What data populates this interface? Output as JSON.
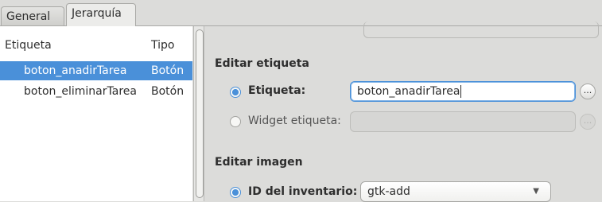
{
  "tabs": [
    {
      "label": "General"
    },
    {
      "label": "Jerarquía"
    }
  ],
  "tree": {
    "columns": [
      "Etiqueta",
      "Tipo"
    ],
    "rows": [
      {
        "etiqueta": "boton_anadirTarea",
        "tipo": "Botón"
      },
      {
        "etiqueta": "boton_eliminarTarea",
        "tipo": "Botón"
      }
    ]
  },
  "editor": {
    "edit_label_section": "Editar etiqueta",
    "label_option": "Etiqueta:",
    "label_value": "boton_anadirTarea",
    "widget_label_option": "Widget etiqueta:",
    "widget_label_value": "",
    "edit_image_section": "Editar imagen",
    "stock_id_option": "ID del inventario:",
    "stock_id_value": "gtk-add",
    "dots_label": "...",
    "dropdown_arrow": "▼"
  },
  "colors": {
    "selection": "#4a90d9",
    "background": "#dcdcda"
  }
}
